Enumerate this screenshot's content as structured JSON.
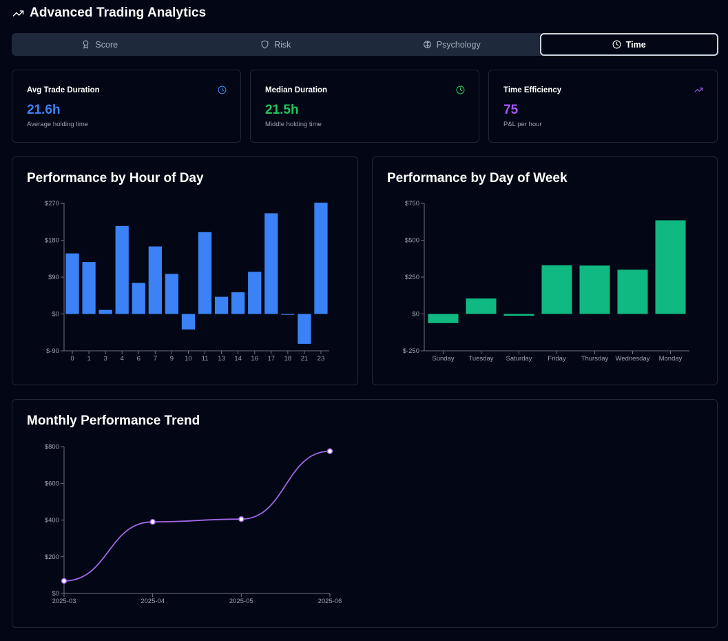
{
  "header": {
    "title": "Advanced Trading Analytics",
    "icon": "trending-up-icon"
  },
  "tabs": [
    {
      "label": "Score",
      "icon": "award-icon",
      "active": false
    },
    {
      "label": "Risk",
      "icon": "shield-icon",
      "active": false
    },
    {
      "label": "Psychology",
      "icon": "brain-icon",
      "active": false
    },
    {
      "label": "Time",
      "icon": "clock-icon",
      "active": true
    }
  ],
  "stats": [
    {
      "label": "Avg Trade Duration",
      "value": "21.6h",
      "sub": "Average holding time",
      "icon": "clock-icon",
      "color": "#3b82f6"
    },
    {
      "label": "Median Duration",
      "value": "21.5h",
      "sub": "Middle holding time",
      "icon": "clock-icon",
      "color": "#22c55e"
    },
    {
      "label": "Time Efficiency",
      "value": "75",
      "sub": "P&L per hour",
      "icon": "trending-up-icon",
      "color": "#a855f7"
    }
  ],
  "chart_data": [
    {
      "type": "bar",
      "title": "Performance by Hour of Day",
      "categories": [
        "0",
        "1",
        "3",
        "4",
        "6",
        "7",
        "9",
        "10",
        "11",
        "13",
        "14",
        "16",
        "17",
        "18",
        "21",
        "23"
      ],
      "values": [
        148,
        127,
        10,
        215,
        76,
        165,
        98,
        -38,
        200,
        42,
        53,
        103,
        246,
        -2,
        -73,
        272
      ],
      "yticks": [
        -90,
        0,
        90,
        180,
        270
      ],
      "ytick_labels": [
        "$-90",
        "$0",
        "$90",
        "$180",
        "$270"
      ],
      "ylim": [
        -90,
        272
      ],
      "color": "#3b82f6",
      "grid": false
    },
    {
      "type": "bar",
      "title": "Performance by Day of Week",
      "categories": [
        "Sunday",
        "Tuesday",
        "Saturday",
        "Friday",
        "Thursday",
        "Wednesday",
        "Monday"
      ],
      "values": [
        -62,
        105,
        -12,
        330,
        328,
        300,
        635
      ],
      "yticks": [
        -250,
        0,
        250,
        500,
        750
      ],
      "ytick_labels": [
        "$-250",
        "$0",
        "$250",
        "$500",
        "$750"
      ],
      "ylim": [
        -250,
        750
      ],
      "color": "#10b981",
      "grid": false
    },
    {
      "type": "line",
      "title": "Monthly Performance Trend",
      "x": [
        "2025-03",
        "2025-04",
        "2025-05",
        "2025-06"
      ],
      "values": [
        68,
        390,
        405,
        775
      ],
      "yticks": [
        0,
        200,
        400,
        600,
        800
      ],
      "ytick_labels": [
        "$0",
        "$200",
        "$400",
        "$600",
        "$800"
      ],
      "ylim": [
        0,
        800
      ],
      "color": "#9f67e6",
      "grid": false
    }
  ]
}
